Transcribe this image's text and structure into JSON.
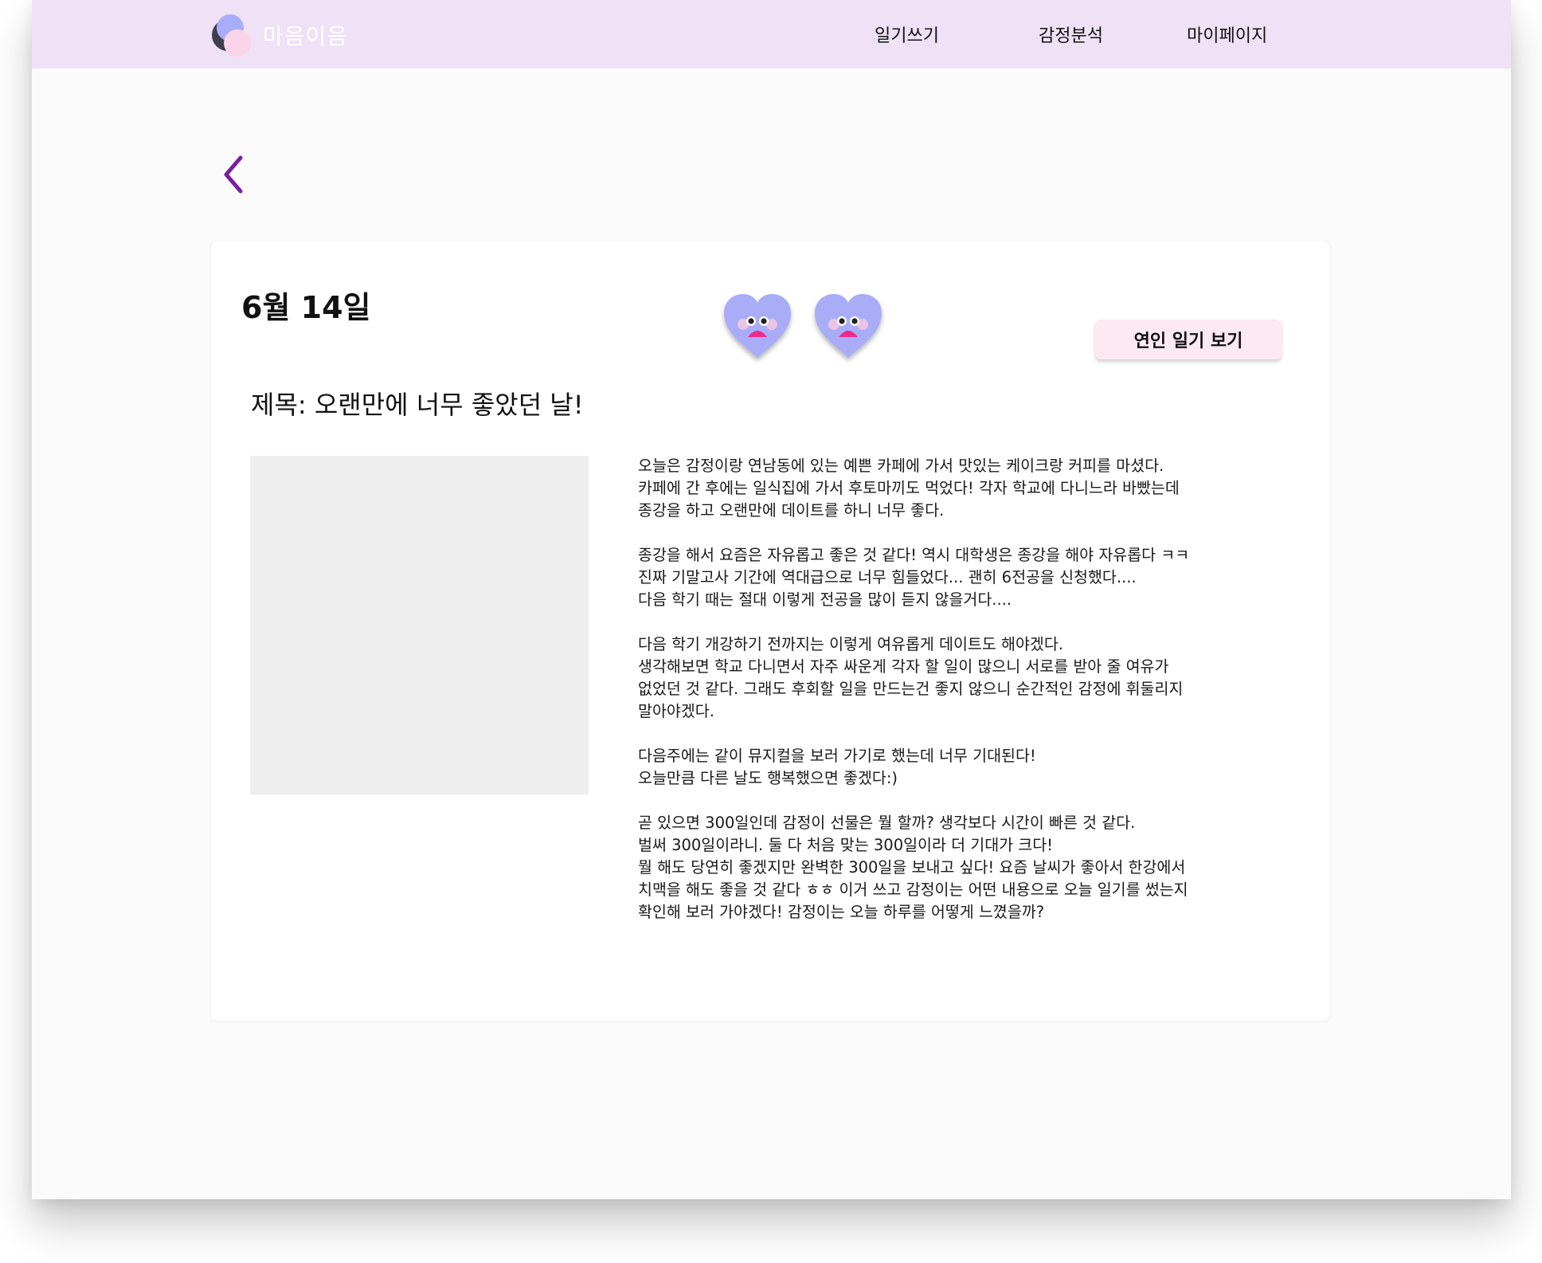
{
  "header": {
    "brand": "마음이음",
    "nav": [
      {
        "label": "일기쓰기"
      },
      {
        "label": "감정분석"
      },
      {
        "label": "마이페이지"
      }
    ]
  },
  "diary": {
    "date": "6월 14일",
    "title": "제목: 오랜만에 너무 좋았던 날!",
    "partner_button": "연인 일기 보기",
    "emotions": [
      "heart-face",
      "heart-face"
    ],
    "paragraphs": [
      [
        "오늘은 감정이랑 연남동에 있는 예쁜 카페에 가서 맛있는 케이크랑 커피를 마셨다.",
        "카페에 간 후에는 일식집에 가서 후토마끼도 먹었다! 각자 학교에 다니느라 바빴는데",
        "종강을 하고 오랜만에 데이트를 하니 너무 좋다."
      ],
      [
        "종강을 해서 요즘은 자유롭고 좋은 것 같다! 역시 대학생은 종강을 해야 자유롭다 ㅋㅋ",
        "진짜 기말고사 기간에 역대급으로 너무 힘들었다... 괜히 6전공을 신청했다....",
        "다음 학기 때는 절대 이렇게 전공을 많이 듣지 않을거다...."
      ],
      [
        "다음 학기 개강하기 전까지는 이렇게 여유롭게 데이트도 해야겠다.",
        "생각해보면 학교 다니면서 자주 싸운게 각자 할 일이 많으니 서로를 받아 줄 여유가",
        "없었던 것 같다. 그래도 후회할 일을 만드는건 좋지 않으니 순간적인 감정에 휘둘리지",
        "말아야겠다."
      ],
      [
        "다음주에는 같이 뮤지컬을 보러 가기로 했는데 너무 기대된다!",
        "오늘만큼 다른 날도 행복했으면 좋겠다:)"
      ],
      [
        "곧 있으면 300일인데 감정이 선물은 뭘 할까? 생각보다 시간이 빠른 것 같다.",
        "벌써 300일이라니. 둘 다 처음 맞는 300일이라 더 기대가 크다!",
        "뭘 해도 당연히 좋겠지만 완벽한 300일을 보내고 싶다! 요즘 날씨가 좋아서 한강에서",
        "치맥을 해도 좋을 것 같다 ㅎㅎ 이거 쓰고 감정이는 어떤 내용으로 오늘 일기를 썼는지",
        "확인해 보러 가야겠다! 감정이는 오늘 하루를 어떻게 느꼈을까?"
      ]
    ]
  },
  "colors": {
    "navbar": "#efe1f6",
    "accent": "#7a1fa2",
    "heart": "#a9adf7",
    "mouth": "#ee2a8e",
    "button": "#fde9f1"
  }
}
